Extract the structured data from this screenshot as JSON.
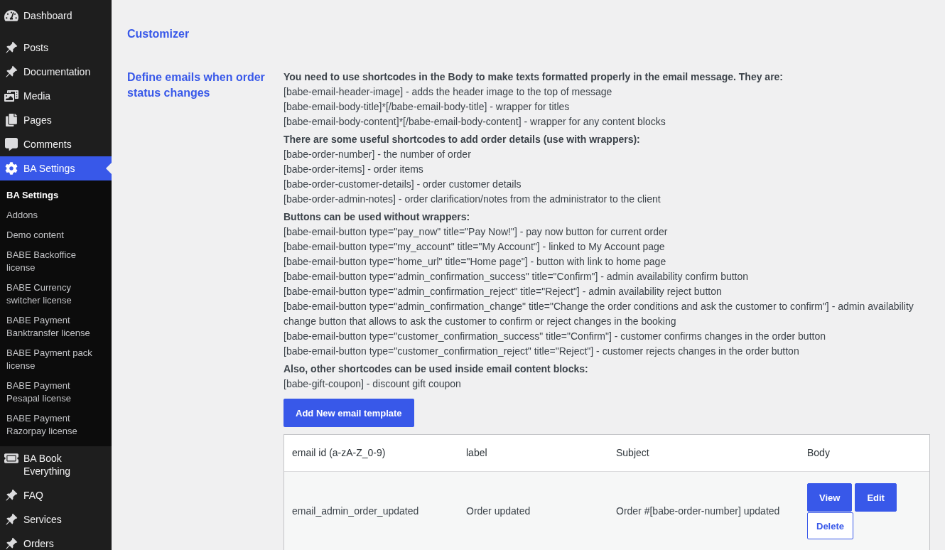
{
  "sidebar": {
    "menu": [
      {
        "label": "Dashboard",
        "selected": false
      },
      {
        "label": "Posts",
        "selected": false
      },
      {
        "label": "Documentation",
        "selected": false
      },
      {
        "label": "Media",
        "selected": false
      },
      {
        "label": "Pages",
        "selected": false
      },
      {
        "label": "Comments",
        "selected": false
      },
      {
        "label": "BA Settings",
        "selected": true,
        "submenu": [
          {
            "label": "BA Settings",
            "selected": true
          },
          {
            "label": "Addons",
            "selected": false
          },
          {
            "label": "Demo content",
            "selected": false
          },
          {
            "label": "BABE Backoffice license",
            "selected": false
          },
          {
            "label": "BABE Currency switcher license",
            "selected": false
          },
          {
            "label": "BABE Payment Banktransfer license",
            "selected": false
          },
          {
            "label": "BABE Payment pack license",
            "selected": false
          },
          {
            "label": "BABE Payment Pesapal license",
            "selected": false
          },
          {
            "label": "BABE Payment Razorpay license",
            "selected": false
          }
        ]
      },
      {
        "label": "BA Book Everything",
        "selected": false
      },
      {
        "label": "FAQ",
        "selected": false
      },
      {
        "label": "Services",
        "selected": false
      },
      {
        "label": "Orders",
        "selected": false
      }
    ]
  },
  "page": {
    "title": "Customizer",
    "setting": {
      "label": "Define emails when order status changes",
      "description": [
        {
          "heading": "You need to use shortcodes in the Body to make texts formatted properly in the email message. They are:",
          "lines": [
            "[babe-email-header-image] - adds the header image to the top of message",
            "[babe-email-body-title]*[/babe-email-body-title] - wrapper for titles",
            "[babe-email-body-content]*[/babe-email-body-content] - wrapper for any content blocks"
          ]
        },
        {
          "heading": "There are some useful shortcodes to add order details (use with wrappers):",
          "lines": [
            "[babe-order-number] - the number of order",
            "[babe-order-items] - order items",
            "[babe-order-customer-details] - order customer details",
            "[babe-order-admin-notes] - order clarification/notes from the administrator to the client"
          ]
        },
        {
          "heading": "Buttons can be used without wrappers:",
          "lines": [
            "[babe-email-button type=\"pay_now\" title=\"Pay Now!\"] - pay now button for current order",
            "[babe-email-button type=\"my_account\" title=\"My Account\"] - linked to My Account page",
            "[babe-email-button type=\"home_url\" title=\"Home page\"] - button with link to home page",
            "[babe-email-button type=\"admin_confirmation_success\" title=\"Confirm\"] - admin availability confirm button",
            "[babe-email-button type=\"admin_confirmation_reject\" title=\"Reject\"] - admin availability reject button",
            "[babe-email-button type=\"admin_confirmation_change\" title=\"Change the order conditions and ask the customer to confirm\"] - admin availability change button that allows to ask the customer to confirm or reject changes in the booking",
            "[babe-email-button type=\"customer_confirmation_success\" title=\"Confirm\"] - customer confirms changes in the order button",
            "[babe-email-button type=\"customer_confirmation_reject\" title=\"Reject\"] - customer rejects changes in the order button"
          ]
        },
        {
          "heading": "Also, other shortcodes can be used inside email content blocks:",
          "lines": [
            "[babe-gift-coupon] - discount gift coupon"
          ]
        }
      ],
      "add_button": "Add New email template",
      "table": {
        "columns": [
          "email id (a-zA-Z_0-9)",
          "label",
          "Subject",
          "Body"
        ],
        "rows": [
          {
            "cells": [
              "email_admin_order_updated",
              "Order updated",
              "Order #[babe-order-number] updated"
            ],
            "actions": [
              {
                "label": "View",
                "kind": "primary"
              },
              {
                "label": "Edit",
                "kind": "primary"
              },
              {
                "label": "Delete",
                "kind": "secondary"
              }
            ]
          }
        ]
      }
    }
  }
}
